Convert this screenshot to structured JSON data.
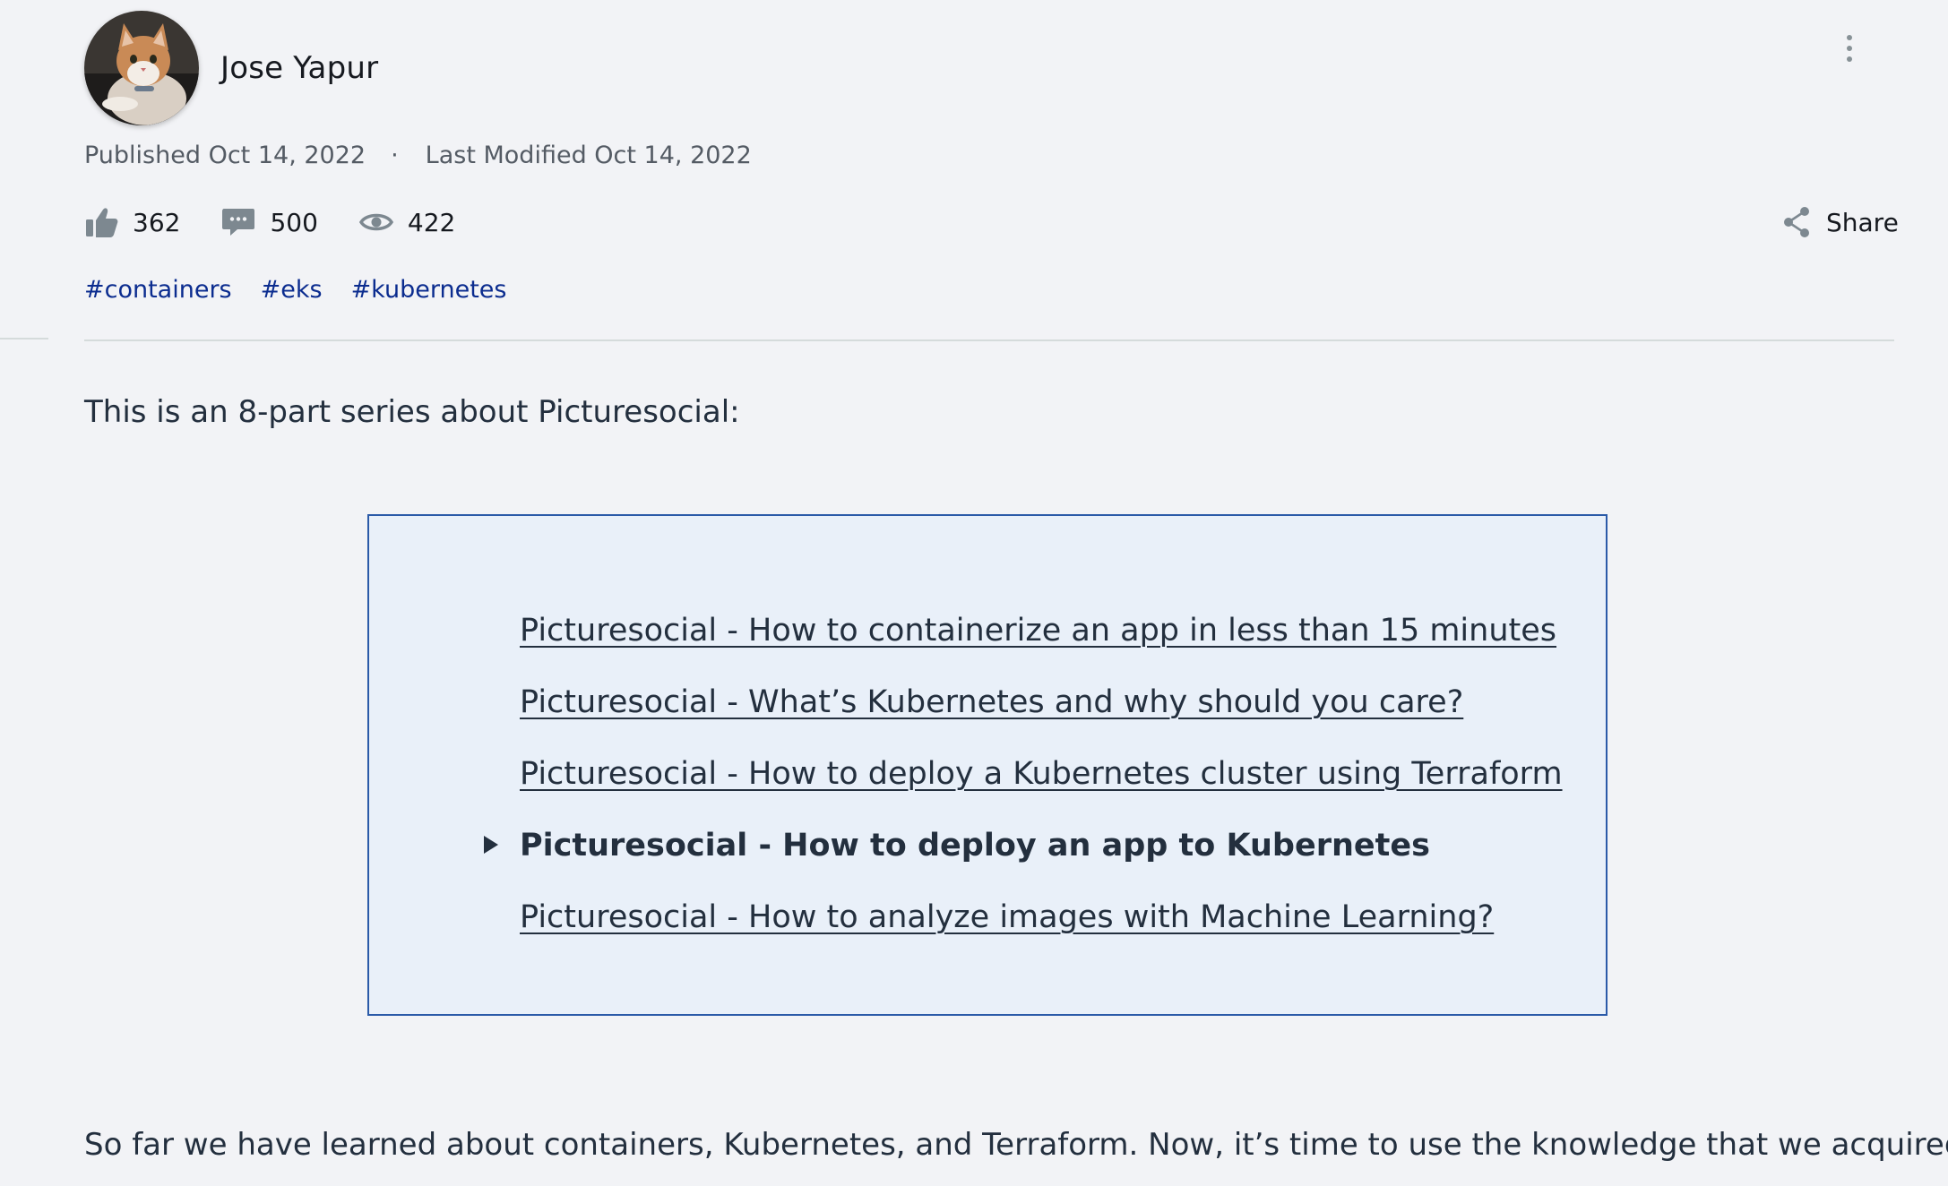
{
  "author": {
    "name": "Jose Yapur",
    "avatar_icon": "cat-avatar"
  },
  "meta": {
    "published": "Published Oct 14, 2022",
    "separator": "·",
    "modified": "Last Modified Oct 14, 2022"
  },
  "stats": {
    "likes": "362",
    "comments": "500",
    "views": "422"
  },
  "share": {
    "label": "Share"
  },
  "tags": [
    "#containers",
    "#eks",
    "#kubernetes"
  ],
  "intro": "This is an 8-part series about Picturesocial:",
  "series": [
    {
      "title": "Picturesocial - How to containerize an app in less than 15 minutes",
      "current": false
    },
    {
      "title": "Picturesocial - What’s Kubernetes and why should you care?",
      "current": false
    },
    {
      "title": "Picturesocial - How to deploy a Kubernetes cluster using Terraform",
      "current": false
    },
    {
      "title": "Picturesocial - How to deploy an app to Kubernetes",
      "current": true
    },
    {
      "title": "Picturesocial - How to analyze images with Machine Learning?",
      "current": false
    }
  ],
  "body_first_line": "So far we have learned about containers, Kubernetes, and Terraform. Now, it’s time to use the knowledge that we acquired",
  "colors": {
    "background": "#f2f3f6",
    "tag_link": "#0b2c8f",
    "box_background": "#e9f0f9",
    "box_border": "#2b5aa8"
  }
}
